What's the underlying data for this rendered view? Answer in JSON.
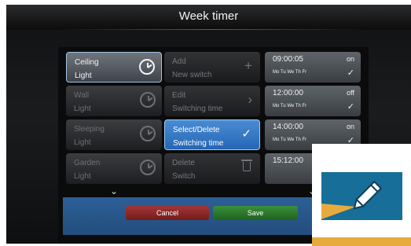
{
  "window": {
    "title": "Week timer"
  },
  "rooms": [
    {
      "name": "Ceiling",
      "type": "Light",
      "selected": true
    },
    {
      "name": "Wall",
      "type": "Light",
      "selected": false
    },
    {
      "name": "Sleeping",
      "type": "Light",
      "selected": false
    },
    {
      "name": "Garden",
      "type": "Light",
      "selected": false
    }
  ],
  "actions": [
    {
      "line1": "Add",
      "line2": "New switch",
      "icon": "plus-icon",
      "selected": false
    },
    {
      "line1": "Edit",
      "line2": "Switching time",
      "icon": "chevron-right-icon",
      "selected": false
    },
    {
      "line1": "Select/Delete",
      "line2": "Switching time",
      "icon": "check-icon",
      "selected": true
    },
    {
      "line1": "Delete",
      "line2": "Switch",
      "icon": "trash-icon",
      "selected": false
    }
  ],
  "times": [
    {
      "time": "09:00:05",
      "state": "on",
      "days": "Mo Tu We Th Fr",
      "checked": true
    },
    {
      "time": "12:00:00",
      "state": "off",
      "days": "Mo Tu We Th Fr",
      "checked": true
    },
    {
      "time": "14:00:00",
      "state": "on",
      "days": "Mo Tu We Th Fr",
      "checked": true
    },
    {
      "time": "15:12:00",
      "state": "",
      "days": "",
      "checked": false
    }
  ],
  "footer": {
    "cancel_label": "Cancel",
    "save_label": "Save"
  },
  "glyphs": {
    "plus": "+",
    "chevron_right": "›",
    "check": "✓",
    "chevron_down": "⌄"
  },
  "colors": {
    "selection_blue": "#2d73c4",
    "cancel_red": "#8f2a2a",
    "save_green": "#2f7d2f",
    "overlay_card_blue": "#176e98",
    "overlay_stripe_gold": "#e6ab3c"
  }
}
